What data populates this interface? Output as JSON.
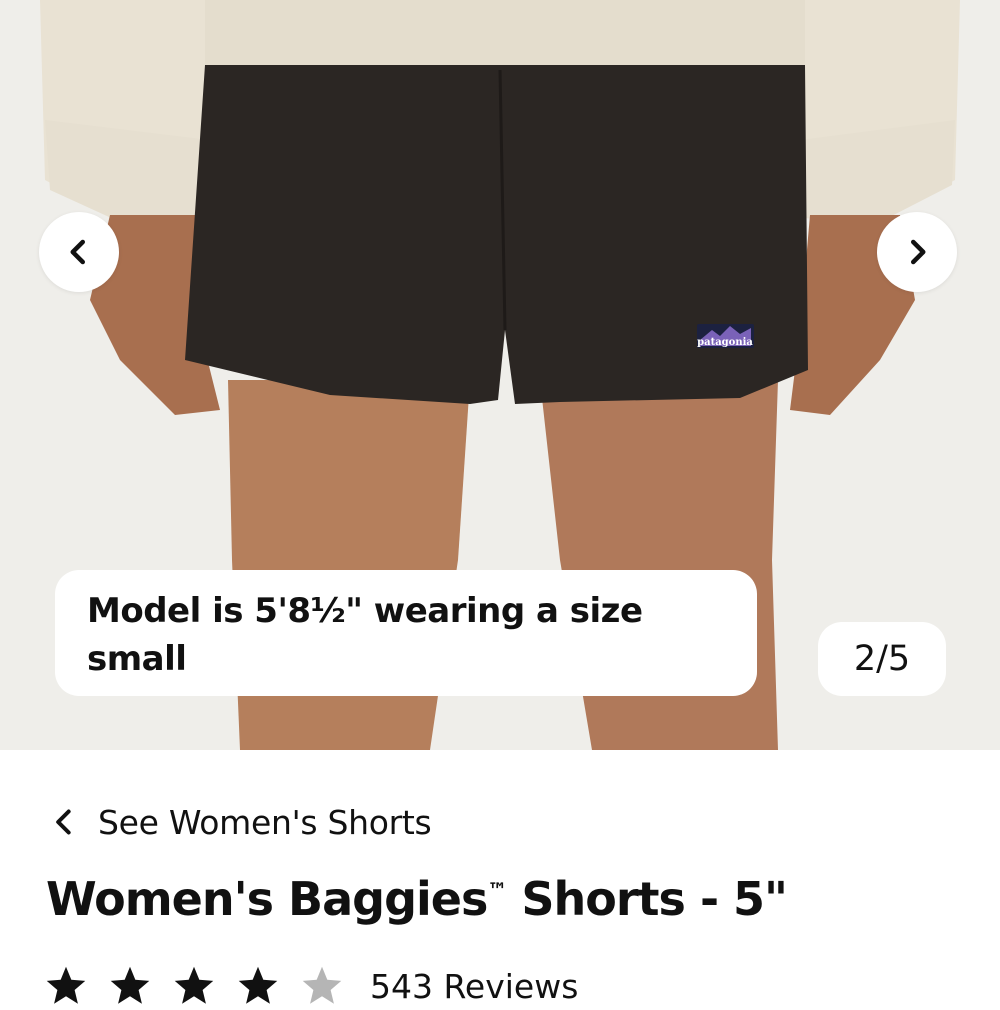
{
  "gallery": {
    "caption": "Model is 5'8½\" wearing a size small",
    "counter": "2/5",
    "brand_label": "patagonia",
    "prev_icon": "chevron-left-icon",
    "next_icon": "chevron-right-icon"
  },
  "breadcrumb": {
    "label": "See Women's Shorts",
    "icon": "chevron-left-icon"
  },
  "product": {
    "title": "Women's Baggies",
    "trademark": "™",
    "title_suffix": " Shorts - 5\""
  },
  "rating": {
    "stars": 4,
    "max_stars": 5,
    "reviews": "543 Reviews",
    "filled_color": "#111111",
    "empty_color": "#b5b5b5"
  }
}
